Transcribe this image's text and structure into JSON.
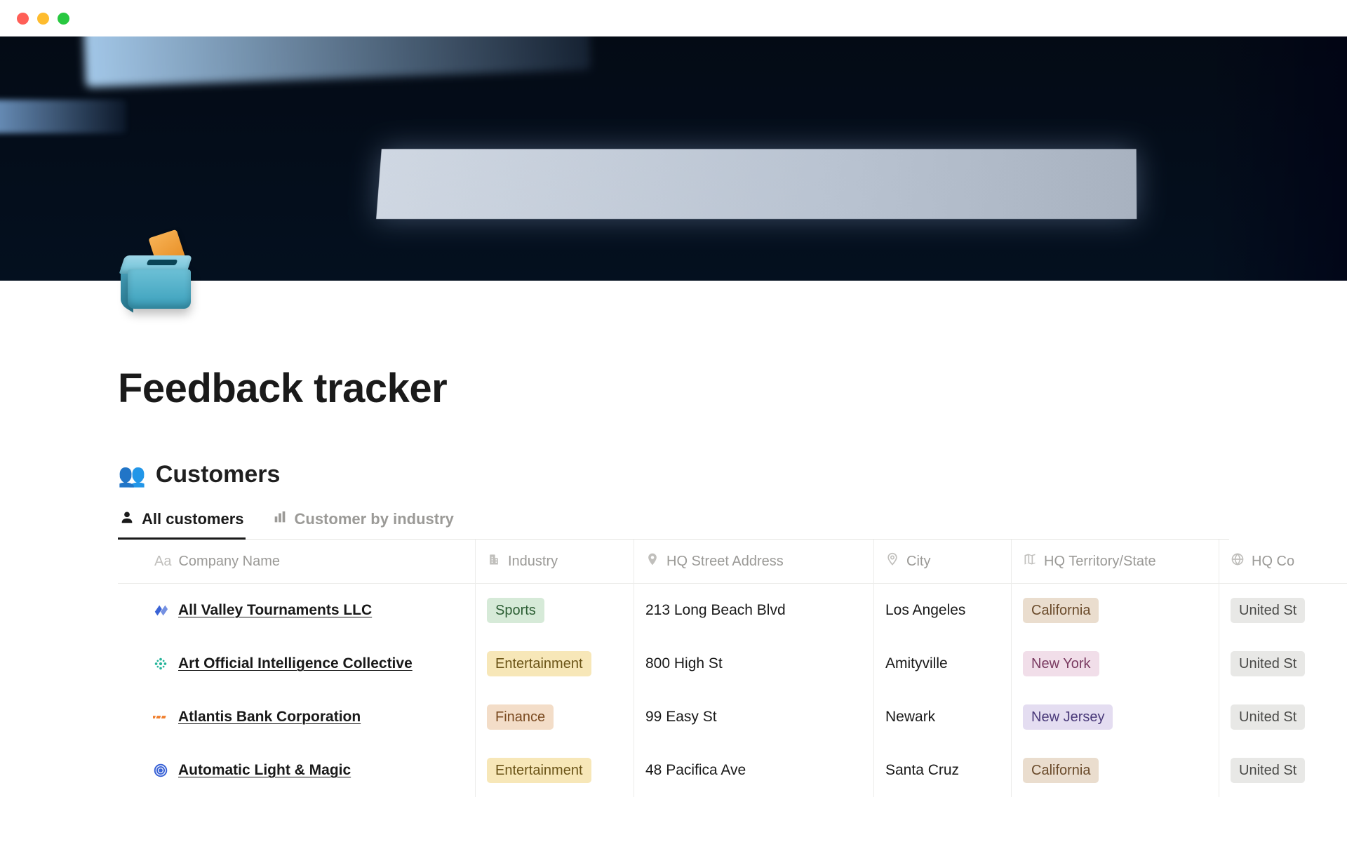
{
  "page": {
    "title": "Feedback tracker"
  },
  "section": {
    "icon": "👥",
    "title": "Customers"
  },
  "views": [
    {
      "label": "All customers",
      "icon": "person",
      "active": true
    },
    {
      "label": "Customer by industry",
      "icon": "bars",
      "active": false
    }
  ],
  "columns": [
    {
      "label": "Company Name",
      "icon": "Aa"
    },
    {
      "label": "Industry",
      "icon": "building"
    },
    {
      "label": "HQ Street Address",
      "icon": "pin"
    },
    {
      "label": "City",
      "icon": "pin-open"
    },
    {
      "label": "HQ Territory/State",
      "icon": "map"
    },
    {
      "label": "HQ Co",
      "icon": "globe"
    }
  ],
  "tag_styles": {
    "Sports": "tag-green",
    "Entertainment": "tag-yellow",
    "Finance": "tag-orange",
    "California": "tag-brown",
    "New York": "tag-pink",
    "New Jersey": "tag-purple",
    "United St": "tag-gray"
  },
  "rows": [
    {
      "logo_color": "#3a63d6",
      "company": "All Valley Tournaments LLC",
      "industry": "Sports",
      "address": "213 Long Beach Blvd",
      "city": "Los Angeles",
      "state": "California",
      "country": "United St"
    },
    {
      "logo_color": "#27b59b",
      "company": "Art Official Intelligence Collective",
      "industry": "Entertainment",
      "address": "800 High St",
      "city": "Amityville",
      "state": "New York",
      "country": "United St"
    },
    {
      "logo_color": "#f07f2e",
      "company": "Atlantis Bank Corporation",
      "industry": "Finance",
      "address": "99 Easy St",
      "city": "Newark",
      "state": "New Jersey",
      "country": "United St"
    },
    {
      "logo_color": "#3a63d6",
      "company": "Automatic Light & Magic",
      "industry": "Entertainment",
      "address": "48 Pacifica Ave",
      "city": "Santa Cruz",
      "state": "California",
      "country": "United St"
    }
  ]
}
